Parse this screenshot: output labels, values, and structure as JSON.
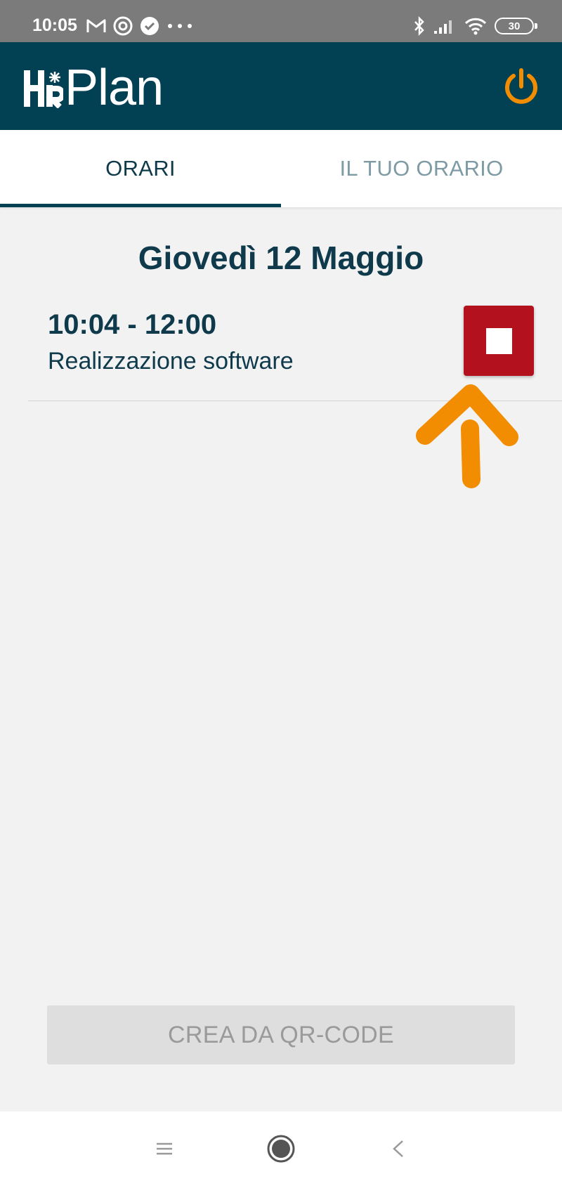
{
  "status_bar": {
    "time": "10:05",
    "left_icons": [
      "gmail-icon",
      "sync-icon",
      "verified-icon",
      "more-dots-icon"
    ],
    "right_icons": [
      "bluetooth-icon",
      "signal-icon",
      "wifi-icon"
    ],
    "battery": "30"
  },
  "app_bar": {
    "logo_text_plan": "Plan",
    "power_icon": "power-icon",
    "accent_color": "#f28c00",
    "background_color": "#024154"
  },
  "tabs": [
    {
      "label": "ORARI",
      "active": true
    },
    {
      "label": "IL TUO ORARIO",
      "active": false
    }
  ],
  "day": {
    "title": "Giovedì 12 Maggio"
  },
  "entries": [
    {
      "time": "10:04 - 12:00",
      "description": "Realizzazione software",
      "action_icon": "stop-icon",
      "action_color": "#b3111d"
    }
  ],
  "annotation": {
    "icon": "arrow-up-icon",
    "color": "#f28c00"
  },
  "qr_button": {
    "label": "CREA DA QR-CODE"
  },
  "nav_bar": {
    "icons": [
      "menu-icon",
      "home-icon",
      "back-icon"
    ]
  }
}
